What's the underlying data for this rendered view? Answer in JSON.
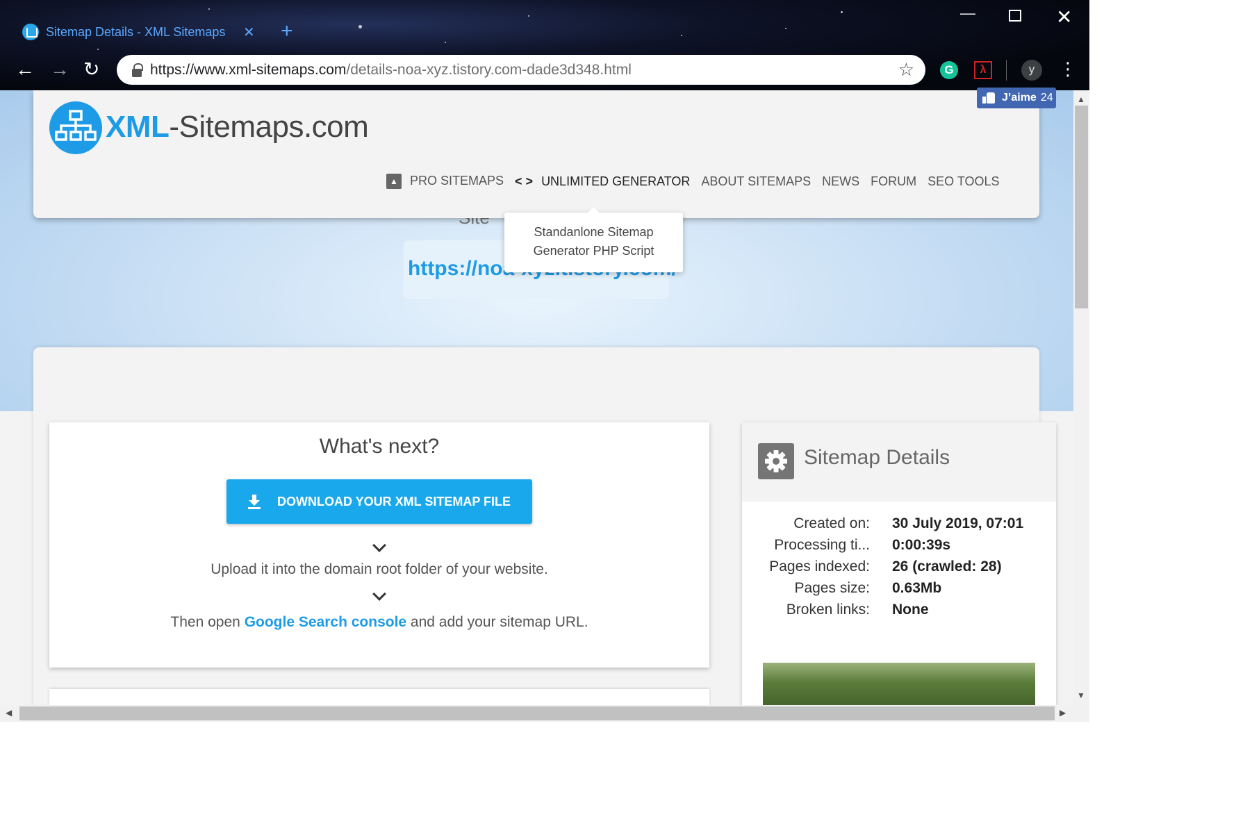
{
  "browser": {
    "tab_title": "Sitemap Details - XML Sitemaps",
    "tab_close": "✕",
    "new_tab": "+",
    "url_host": "https://www.xml-sitemaps.com",
    "url_path": "/details-noa-xyz.tistory.com-dade3d348.html",
    "profile_initial": "y",
    "ext_grammarly": "G"
  },
  "site": {
    "logo_xml": "XML",
    "logo_rest": "-Sitemaps.com",
    "menu": [
      {
        "label": "PRO SITEMAPS",
        "icon": "pro-icon"
      },
      {
        "label": "UNLIMITED GENERATOR",
        "icon": "code-icon"
      },
      {
        "label": "ABOUT SITEMAPS"
      },
      {
        "label": "NEWS"
      },
      {
        "label": "FORUM"
      },
      {
        "label": "SEO TOOLS"
      }
    ],
    "fb_like_label": "J’aime",
    "fb_like_count": "24",
    "tooltip_line1": "Standanlone Sitemap",
    "tooltip_line2": "Generator PHP Script"
  },
  "hero": {
    "partial_heading": "Site",
    "site_url": "https://noa-xyz.tistory.com/"
  },
  "next": {
    "title": "What's next?",
    "download_label": "DOWNLOAD YOUR XML SITEMAP FILE",
    "step1": "Upload it into the domain root folder of your website.",
    "step2_prefix": "Then open ",
    "step2_link": "Google Search console",
    "step2_suffix": " and add your sitemap URL."
  },
  "details": {
    "title": "Sitemap Details",
    "rows": [
      {
        "label": "Created on:",
        "value": "30 July 2019, 07:01"
      },
      {
        "label": "Processing ti...",
        "value": "0:00:39s"
      },
      {
        "label": "Pages indexed:",
        "value": "26 (crawled: 28)"
      },
      {
        "label": "Pages size:",
        "value": "0.63Mb"
      },
      {
        "label": "Broken links:",
        "value": "None"
      }
    ]
  },
  "colors": {
    "brand": "#1d9be6",
    "button": "#1aa8ec",
    "facebook": "#4267b2"
  }
}
